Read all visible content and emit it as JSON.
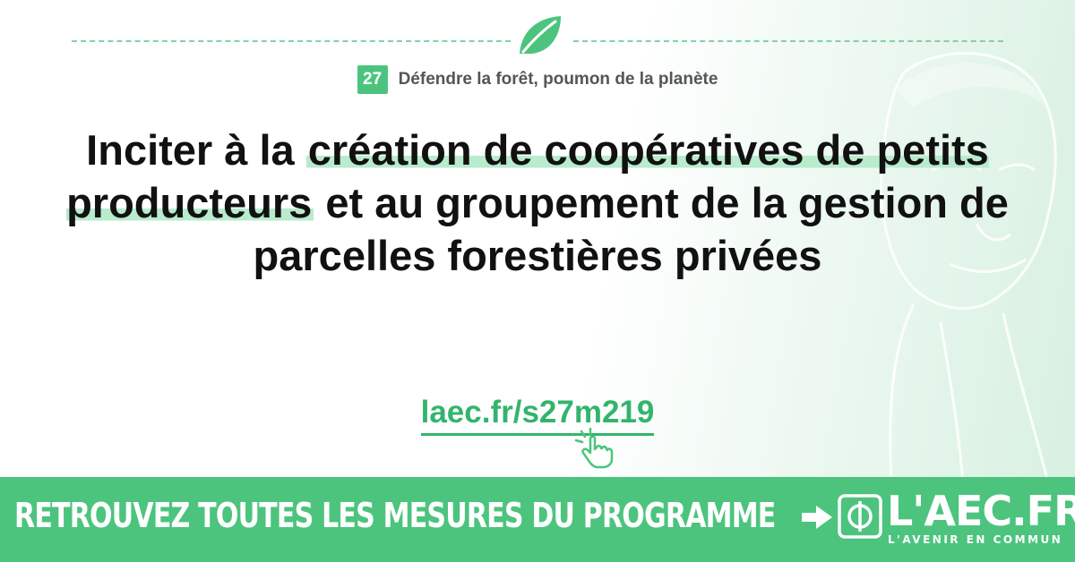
{
  "chapter": {
    "number": "27",
    "title": "Défendre la forêt, poumon de la planète"
  },
  "headline": {
    "part1": "Inciter à la ",
    "highlight": "création de coopératives de petits producteurs",
    "part2": " et au groupement de la gestion de parcelles forestières privées"
  },
  "link": {
    "text": "laec.fr/s27m219"
  },
  "banner": {
    "cta": "RETROUVEZ TOUTES LES MESURES DU PROGRAMME",
    "logo": "L'AEC.FR",
    "logo_tagline": "L'AVENIR EN COMMUN"
  },
  "colors": {
    "accent": "#4cc47e",
    "link": "#33b46d",
    "highlight": "#b9ebcd",
    "text": "#111111"
  },
  "icons": [
    "leaf-icon",
    "click-hand-icon",
    "arrow-right-icon",
    "phi-emblem-icon"
  ]
}
